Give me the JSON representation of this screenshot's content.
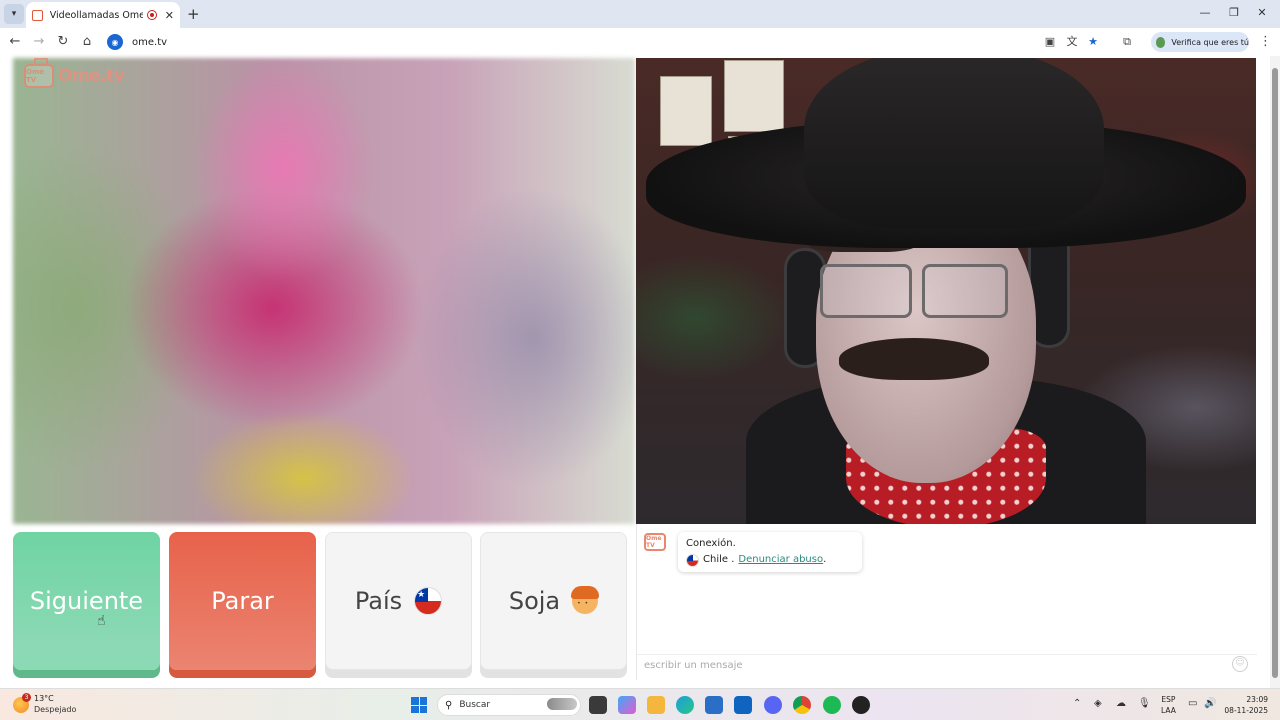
{
  "browser": {
    "tab_title": "Videollamadas OmeTV — A",
    "url": "ome.tv",
    "verify_label": "Verifica que eres tú"
  },
  "page": {
    "logo_text": "Ome.tv",
    "logo_badge": "Ome TV",
    "buttons": {
      "next": "Siguiente",
      "stop": "Parar",
      "country": "País",
      "gender": "Soja"
    },
    "chat": {
      "connection_text": "Conexión.",
      "country": "Chile .",
      "abuse_link": "Denunciar abuso",
      "period": ".",
      "input_placeholder": "escribir un mensaje"
    }
  },
  "taskbar": {
    "weather_temp": "13°C",
    "weather_cond": "Despejado",
    "weather_badge": "3",
    "search_placeholder": "Buscar",
    "lang_line1": "ESP",
    "lang_line2": "LAA",
    "time": "23:09",
    "date": "08-11-2025"
  },
  "colors": {
    "next_button": "#6fd4a2",
    "stop_button": "#e8624a",
    "link": "#2a8a7e"
  },
  "icons": [
    "tab-list-icon",
    "record-icon",
    "close-icon",
    "plus-icon",
    "back-icon",
    "forward-icon",
    "reload-icon",
    "home-icon",
    "cast-icon",
    "translate-icon",
    "star-icon",
    "extensions-icon",
    "menu-icon",
    "chile-flag-icon",
    "boy-icon",
    "emoji-icon",
    "windows-start-icon",
    "search-icon"
  ]
}
